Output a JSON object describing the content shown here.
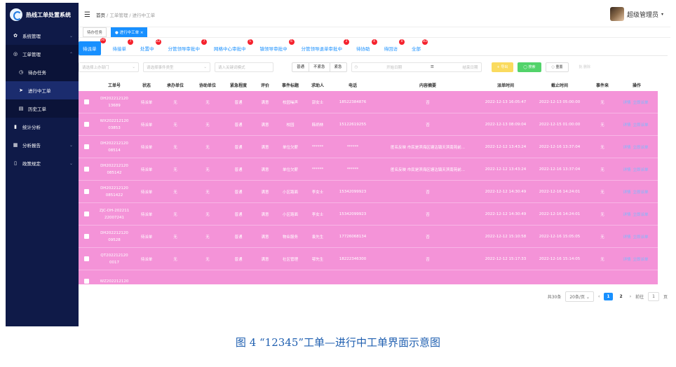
{
  "app": {
    "title": "热线工单处置系统"
  },
  "sidebar": {
    "items": [
      {
        "label": "系统管理",
        "icon": "gear-icon"
      },
      {
        "label": "工单管理",
        "icon": "ticket-icon"
      },
      {
        "label": "待办任务",
        "icon": "todo-icon"
      },
      {
        "label": "进行中工单",
        "icon": "send-icon"
      },
      {
        "label": "历史工单",
        "icon": "doc-icon"
      },
      {
        "label": "统计分析",
        "icon": "bar-chart-icon"
      },
      {
        "label": "分析报告",
        "icon": "report-icon"
      },
      {
        "label": "政策规定",
        "icon": "book-icon"
      }
    ]
  },
  "header": {
    "breadcrumb": [
      "首页",
      "工单管理",
      "进行中工单"
    ],
    "user": "超级管理员"
  },
  "tagsbar": {
    "tabs": [
      "待办任务",
      "进行中工单"
    ]
  },
  "status_tabs": [
    {
      "label": "待派单",
      "count": "30"
    },
    {
      "label": "待接单",
      "count": "7"
    },
    {
      "label": "处置中",
      "count": "22"
    },
    {
      "label": "分管领导审批中",
      "count": "7"
    },
    {
      "label": "网格中心审批中",
      "count": "5"
    },
    {
      "label": "镇领导审批中",
      "count": "6"
    },
    {
      "label": "分管领导退单审批中",
      "count": "2"
    },
    {
      "label": "待协助",
      "count": "4"
    },
    {
      "label": "待回访",
      "count": "0"
    },
    {
      "label": "全部",
      "count": "83"
    }
  ],
  "filters": {
    "dept_placeholder": "请选择上办部门",
    "type_placeholder": "请选择事件类型",
    "keyword_placeholder": "请入关键词模式",
    "urgency": [
      "普通",
      "不紧急",
      "紧急"
    ],
    "start_placeholder": "开始日期",
    "end_placeholder": "结束日期",
    "btn_export": "+ 导出",
    "btn_search": "◯ 搜索",
    "btn_reset": "◌ 重置",
    "btn_delete": "批 删除"
  },
  "table": {
    "headers": [
      "工单号",
      "状态",
      "承办单位",
      "协助单位",
      "紧急程度",
      "评价",
      "事件标题",
      "求助人",
      "电话",
      "内容摘要",
      "派单时间",
      "截止时间",
      "事件来",
      "操作"
    ],
    "rows": [
      [
        "DH202212120\n13689",
        "待派单",
        "无",
        "无",
        "普通",
        "满意",
        "校园噪声",
        "郭女士",
        "18522384876",
        "否",
        "2022-12-13 16:05:47",
        "2022-12-13 05:00:00",
        "无"
      ],
      [
        "WX202212120\n03853",
        "待派单",
        "无",
        "无",
        "普通",
        "满意",
        "校园",
        "韩炳林",
        "15122619255",
        "否",
        "2022-12-13 08:09:04",
        "2022-12-15 01:00:00",
        "无"
      ],
      [
        "DH202212120\n08514",
        "待派单",
        "无",
        "无",
        "普通",
        "满意",
        "单位欠薪",
        "******",
        "******",
        "匿名反映 市民是滨海区塘沽镇天滨南苑前...",
        "2022-12-12 13:43:24",
        "2022-12-16 13:37:04",
        "无"
      ],
      [
        "DH202212120\n085142",
        "待派单",
        "无",
        "无",
        "普通",
        "满意",
        "单位欠薪",
        "******",
        "******",
        "匿名反映 市民是滨海区塘沽镇天滨南苑前...",
        "2022-12-12 13:43:24",
        "2022-12-16 13:37:04",
        "无"
      ],
      [
        "DH202212120\n0851422",
        "待派单",
        "无",
        "无",
        "普通",
        "满意",
        "小区路面",
        "李女士",
        "15342099923",
        "否",
        "2022-12-12 14:30:49",
        "2022-12-16 14:24:01",
        "无"
      ],
      [
        "ZJC-DH-202211\n22007241",
        "待派单",
        "无",
        "无",
        "普通",
        "满意",
        "小区路面",
        "李女士",
        "15342099923",
        "否",
        "2022-12-12 14:30:49",
        "2022-12-16 14:24:01",
        "无"
      ],
      [
        "DH202212120\n09528",
        "待派单",
        "无",
        "无",
        "普通",
        "满意",
        "物业服务",
        "袁先生",
        "17726068134",
        "否",
        "2022-12-12 15:10:58",
        "2022-12-16 15:05:05",
        "无"
      ],
      [
        "QT202212120\n0017",
        "待派单",
        "无",
        "无",
        "普通",
        "满意",
        "社区管理",
        "鄂先生",
        "18222346300",
        "否",
        "2022-12-12 15:17:33",
        "2022-12-16 15:14:05",
        "无"
      ],
      [
        "WZ202212120",
        "",
        "",
        "",
        "",
        "",
        "",
        "",
        "",
        "",
        "",
        "",
        ""
      ]
    ],
    "action_labels": [
      "详情",
      "立即派单"
    ]
  },
  "pagination": {
    "total": "共30条",
    "page_size": "20条/页",
    "pages": [
      "1",
      "2"
    ],
    "goto_label": "前往",
    "goto_value": "1",
    "page_unit": "页"
  },
  "caption": "图 4 “12345”工单—进行中工单界面示意图"
}
